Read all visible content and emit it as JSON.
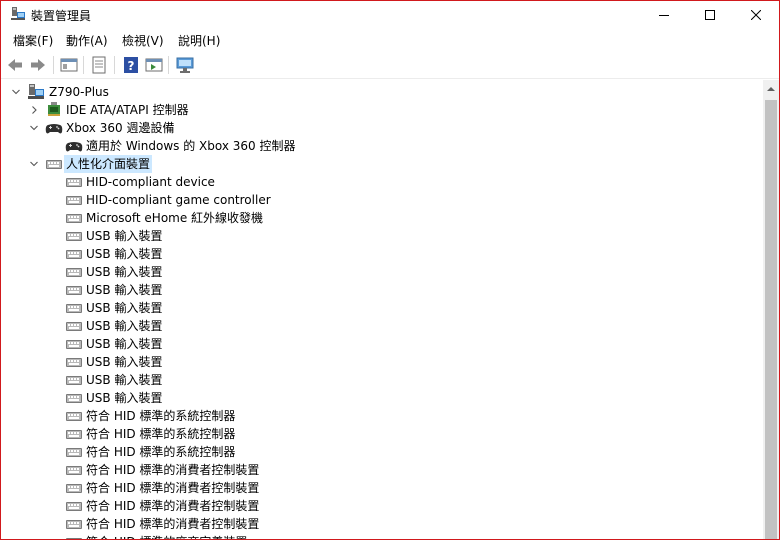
{
  "window": {
    "title": "裝置管理員"
  },
  "menu": [
    {
      "label": "檔案(F)",
      "name": "menu-file"
    },
    {
      "label": "動作(A)",
      "name": "menu-action"
    },
    {
      "label": "檢視(V)",
      "name": "menu-view"
    },
    {
      "label": "說明(H)",
      "name": "menu-help"
    }
  ],
  "toolbar": {
    "buttons": [
      "back-icon",
      "forward-icon",
      "console-tree-icon",
      "properties-icon",
      "help-icon",
      "action-pane-icon",
      "scan-hardware-icon"
    ]
  },
  "tree": {
    "root": "Z790-Plus",
    "nodes": [
      {
        "label": "IDE ATA/ATAPI 控制器",
        "level": 1,
        "expander": "collapsed",
        "icon": "ide-controller-icon"
      },
      {
        "label": "Xbox 360 週邊設備",
        "level": 1,
        "expander": "expanded",
        "icon": "gamepad-icon"
      },
      {
        "label": "適用於 Windows 的 Xbox 360 控制器",
        "level": 2,
        "expander": "none",
        "icon": "gamepad-icon"
      },
      {
        "label": "人性化介面裝置",
        "level": 1,
        "expander": "expanded",
        "icon": "hid-icon",
        "selected": true
      },
      {
        "label": "HID-compliant device",
        "level": 2,
        "expander": "none",
        "icon": "hid-icon"
      },
      {
        "label": "HID-compliant game controller",
        "level": 2,
        "expander": "none",
        "icon": "hid-icon"
      },
      {
        "label": "Microsoft eHome 紅外線收發機",
        "level": 2,
        "expander": "none",
        "icon": "hid-icon"
      },
      {
        "label": "USB 輸入裝置",
        "level": 2,
        "expander": "none",
        "icon": "hid-icon"
      },
      {
        "label": "USB 輸入裝置",
        "level": 2,
        "expander": "none",
        "icon": "hid-icon"
      },
      {
        "label": "USB 輸入裝置",
        "level": 2,
        "expander": "none",
        "icon": "hid-icon"
      },
      {
        "label": "USB 輸入裝置",
        "level": 2,
        "expander": "none",
        "icon": "hid-icon"
      },
      {
        "label": "USB 輸入裝置",
        "level": 2,
        "expander": "none",
        "icon": "hid-icon"
      },
      {
        "label": "USB 輸入裝置",
        "level": 2,
        "expander": "none",
        "icon": "hid-icon"
      },
      {
        "label": "USB 輸入裝置",
        "level": 2,
        "expander": "none",
        "icon": "hid-icon"
      },
      {
        "label": "USB 輸入裝置",
        "level": 2,
        "expander": "none",
        "icon": "hid-icon"
      },
      {
        "label": "USB 輸入裝置",
        "level": 2,
        "expander": "none",
        "icon": "hid-icon"
      },
      {
        "label": "USB 輸入裝置",
        "level": 2,
        "expander": "none",
        "icon": "hid-icon"
      },
      {
        "label": "符合 HID 標準的系統控制器",
        "level": 2,
        "expander": "none",
        "icon": "hid-icon"
      },
      {
        "label": "符合 HID 標準的系統控制器",
        "level": 2,
        "expander": "none",
        "icon": "hid-icon"
      },
      {
        "label": "符合 HID 標準的系統控制器",
        "level": 2,
        "expander": "none",
        "icon": "hid-icon"
      },
      {
        "label": "符合 HID 標準的消費者控制裝置",
        "level": 2,
        "expander": "none",
        "icon": "hid-icon"
      },
      {
        "label": "符合 HID 標準的消費者控制裝置",
        "level": 2,
        "expander": "none",
        "icon": "hid-icon"
      },
      {
        "label": "符合 HID 標準的消費者控制裝置",
        "level": 2,
        "expander": "none",
        "icon": "hid-icon"
      },
      {
        "label": "符合 HID 標準的消費者控制裝置",
        "level": 2,
        "expander": "none",
        "icon": "hid-icon"
      },
      {
        "label": "符合 HID 標準的廠商定義裝置",
        "level": 2,
        "expander": "none",
        "icon": "hid-icon"
      }
    ]
  }
}
